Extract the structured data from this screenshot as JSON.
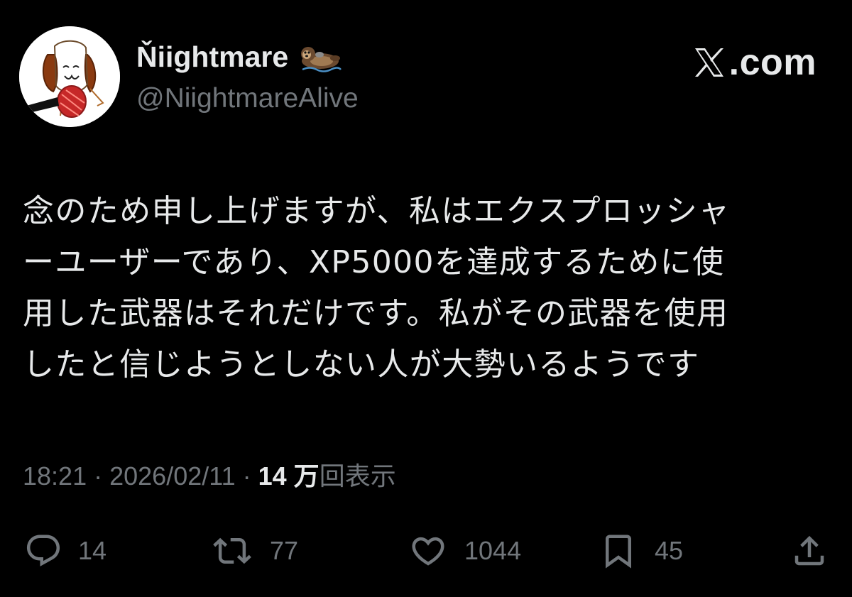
{
  "brand": {
    "text": ".com",
    "icon": "x-logo-icon"
  },
  "author": {
    "display_name": "Ňiightmare",
    "name_emoji": "otter-icon",
    "handle": "@NiightmareAlive"
  },
  "tweet": {
    "lines": [
      "念のため申し上げますが、私はエクスプロッシャ",
      "ーユーザーであり、XP5000を達成するために使",
      "用した武器はそれだけです。私がその武器を使用",
      "したと信じようとしない人が大勢いるようです"
    ],
    "time": "18:21",
    "date": "2026/02/11",
    "separator": "·",
    "views_count": "14 万",
    "views_label": "回表示"
  },
  "actions": {
    "reply": {
      "icon": "reply-icon",
      "count": "14"
    },
    "retweet": {
      "icon": "retweet-icon",
      "count": "77"
    },
    "like": {
      "icon": "heart-icon",
      "count": "1044"
    },
    "bookmark": {
      "icon": "bookmark-icon",
      "count": "45"
    },
    "share": {
      "icon": "share-icon"
    }
  },
  "colors": {
    "background": "#000000",
    "text_primary": "#e7e9ea",
    "text_secondary": "#71767b"
  }
}
